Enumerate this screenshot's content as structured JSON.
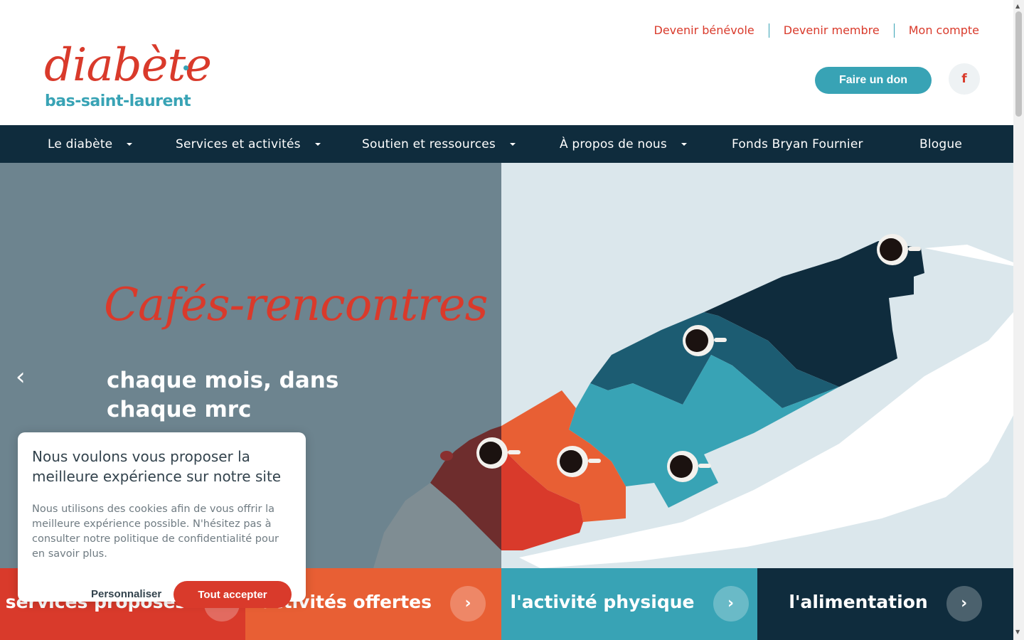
{
  "header": {
    "logo_script": "diabète",
    "logo_sub": "bas-saint-laurent",
    "top_links": [
      "Devenir bénévole",
      "Devenir membre",
      "Mon compte"
    ],
    "donate_label": "Faire un don",
    "facebook_icon": "f"
  },
  "nav": {
    "items": [
      {
        "label": "Le diabète"
      },
      {
        "label": "Services et activités"
      },
      {
        "label": "Soutien et ressources"
      },
      {
        "label": "À propos de nous"
      },
      {
        "label": "Fonds Bryan Fournier"
      },
      {
        "label": "Blogue"
      }
    ]
  },
  "hero": {
    "script_title": "Cafés-rencontres",
    "subtitle_line1": "chaque mois, dans",
    "subtitle_line2": "chaque mrc",
    "prev_icon": "‹"
  },
  "tiles": [
    {
      "label": "services proposés",
      "color": "#d93a2b"
    },
    {
      "label": "activités offertes",
      "color": "#e85f34"
    },
    {
      "label": "l'activité physique",
      "color": "#38a3b5"
    },
    {
      "label": "l'alimentation",
      "color": "#0f2c3d"
    }
  ],
  "cookie": {
    "title": "Nous voulons vous proposer la meilleure expérience sur notre site",
    "text": "Nous utilisons des cookies afin de vous offrir la meilleure expérience possible. N'hésitez pas à consulter notre politique de confidentialité pour en savoir plus.",
    "customize_label": "Personnaliser",
    "accept_label": "Tout accepter"
  },
  "colors": {
    "brand_red": "#d93a2b",
    "brand_teal": "#38a3b5",
    "navy": "#0f2c3d",
    "orange": "#e85f34"
  }
}
